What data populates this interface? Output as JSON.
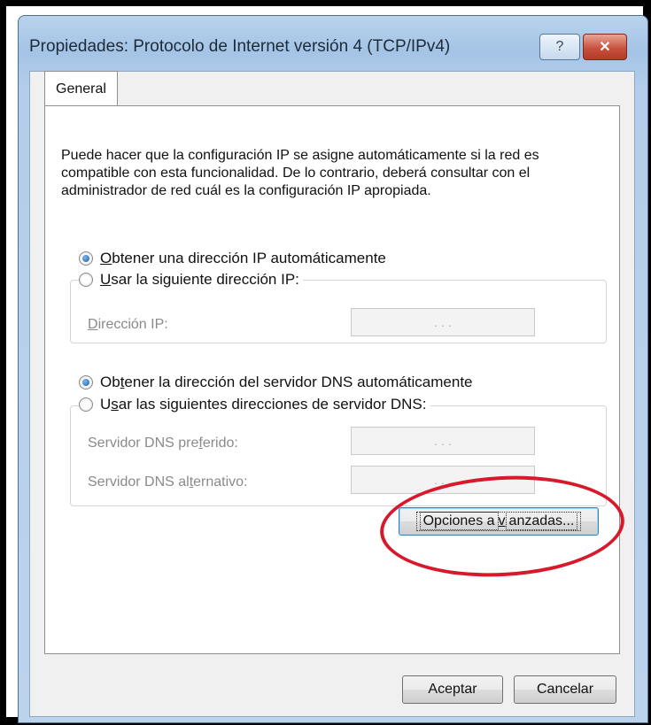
{
  "window": {
    "title": "Propiedades: Protocolo de Internet versión 4 (TCP/IPv4)",
    "help_label": "?",
    "close_label": "✕"
  },
  "tabs": [
    {
      "label": "General",
      "selected": true
    }
  ],
  "description": "Puede hacer que la configuración IP se asigne automáticamente si la red es compatible con esta funcionalidad. De lo contrario, deberá consultar con el administrador de red cuál es la configuración IP apropiada.",
  "ip": {
    "auto_label_pre": "O",
    "auto_label_rest": "btener una dirección IP automáticamente",
    "auto_checked": true,
    "manual_label_pre": "U",
    "manual_label_rest": "sar la siguiente dirección IP:",
    "manual_checked": false,
    "address_label_pre": "D",
    "address_label_rest": "irección IP:",
    "address_value": ". . ."
  },
  "dns": {
    "auto_label_pre": "Ob",
    "auto_label_u": "t",
    "auto_label_rest": "ener la dirección del servidor DNS automáticamente",
    "auto_checked": true,
    "manual_label_pre": "U",
    "manual_label_u": "s",
    "manual_label_rest": "ar las siguientes direcciones de servidor DNS:",
    "manual_checked": false,
    "preferred_label_pre": "Servidor DNS pre",
    "preferred_label_u": "f",
    "preferred_label_rest": "erido:",
    "alternate_label_pre": "Servidor DNS al",
    "alternate_label_u": "t",
    "alternate_label_rest": "ernativo:",
    "preferred_value": ". . .",
    "alternate_value": ". . ."
  },
  "buttons": {
    "advanced_pre": "Opciones a",
    "advanced_u": "v",
    "advanced_rest": "anzadas...",
    "ok": "Aceptar",
    "cancel": "Cancelar"
  },
  "colors": {
    "annotation": "#d7192b",
    "title_bar": "#a4c4e6"
  }
}
